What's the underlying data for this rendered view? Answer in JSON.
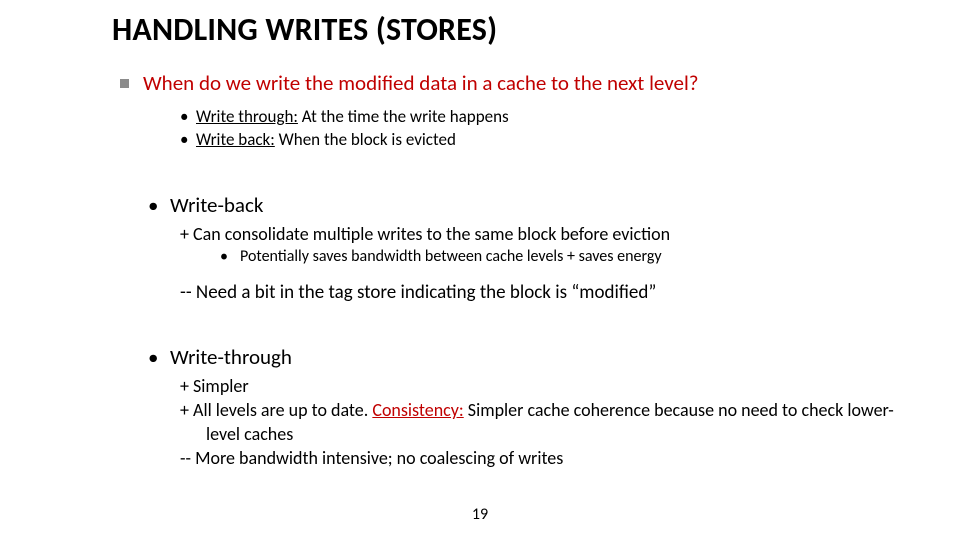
{
  "title": "HANDLING WRITES (STORES)",
  "q": {
    "text": "When do we write the modified data in a cache to the next level?",
    "sub": [
      {
        "lead": "Write through:",
        "rest": " At the time the write happens"
      },
      {
        "lead": "Write back:",
        "rest": " When the block is evicted"
      }
    ]
  },
  "wb": {
    "heading": "Write-back",
    "plus": "+ Can consolidate multiple writes to the same block before eviction",
    "sub": "Potentially saves bandwidth between cache levels + saves energy",
    "minus_pre": "-- Need a bit in the tag store indicating the block is ",
    "minus_quote_open": "“",
    "minus_word": "modified",
    "minus_quote_close": "”"
  },
  "wt": {
    "heading": "Write-through",
    "plus1": "+ Simpler",
    "plus2_pre": "+ All levels are up to date. ",
    "plus2_key": "Consistency:",
    "plus2_rest": " Simpler cache coherence because no need to check lower-level caches",
    "minus": "-- More bandwidth intensive; no coalescing of writes"
  },
  "page": "19"
}
